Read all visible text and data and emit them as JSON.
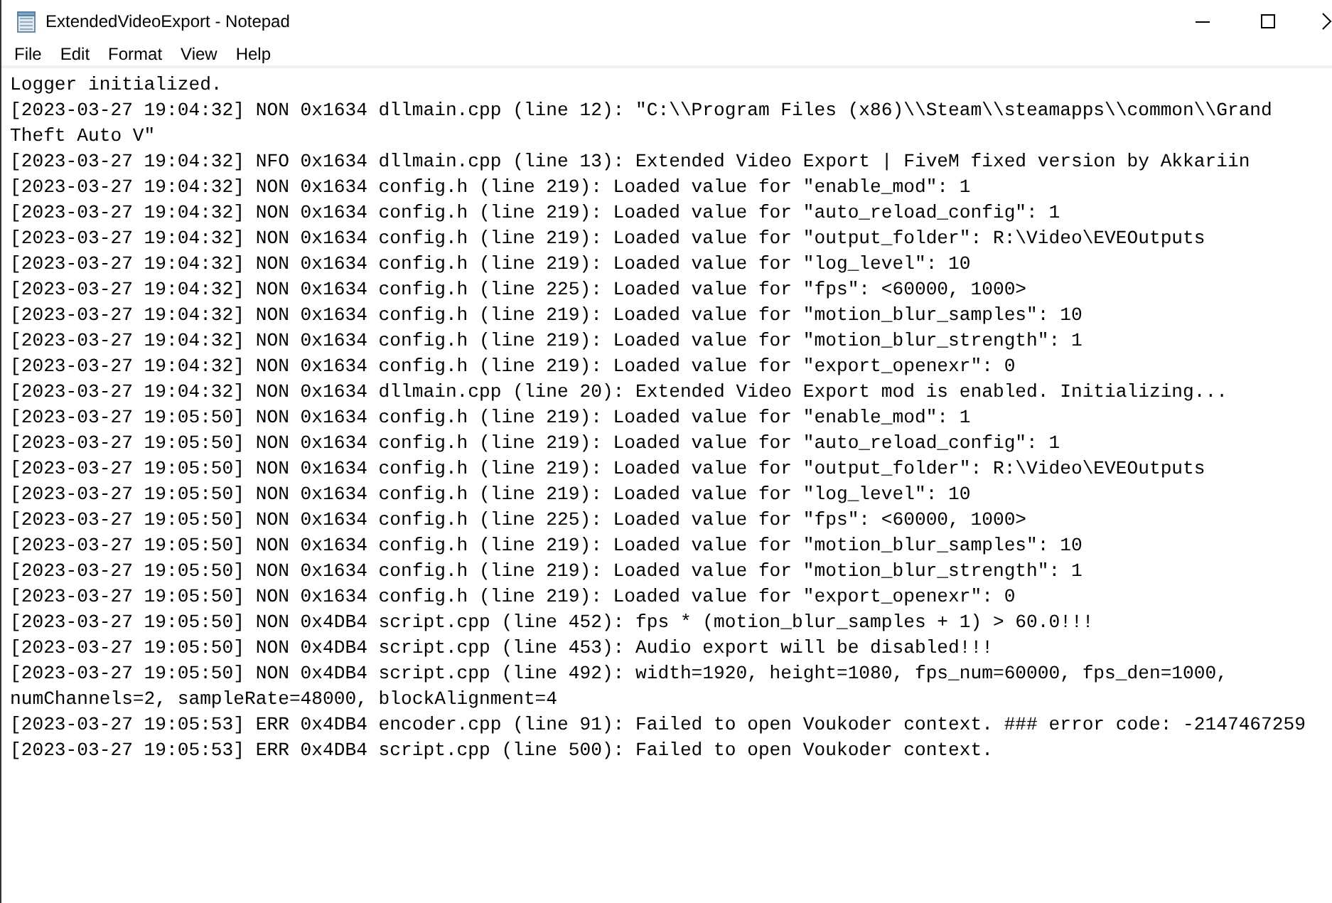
{
  "window": {
    "title": "ExtendedVideoExport - Notepad"
  },
  "menu": [
    "File",
    "Edit",
    "Format",
    "View",
    "Help"
  ],
  "lines": [
    "Logger initialized.",
    "[2023-03-27 19:04:32] NON 0x1634 dllmain.cpp (line 12): \"C:\\\\Program Files (x86)\\\\Steam\\\\steamapps\\\\common\\\\Grand",
    "Theft Auto V\"",
    "[2023-03-27 19:04:32] NFO 0x1634 dllmain.cpp (line 13): Extended Video Export | FiveM fixed version by Akkariin",
    "[2023-03-27 19:04:32] NON 0x1634 config.h (line 219): Loaded value for \"enable_mod\": 1",
    "[2023-03-27 19:04:32] NON 0x1634 config.h (line 219): Loaded value for \"auto_reload_config\": 1",
    "[2023-03-27 19:04:32] NON 0x1634 config.h (line 219): Loaded value for \"output_folder\": R:\\Video\\EVEOutputs",
    "[2023-03-27 19:04:32] NON 0x1634 config.h (line 219): Loaded value for \"log_level\": 10",
    "[2023-03-27 19:04:32] NON 0x1634 config.h (line 225): Loaded value for \"fps\": <60000, 1000>",
    "[2023-03-27 19:04:32] NON 0x1634 config.h (line 219): Loaded value for \"motion_blur_samples\": 10",
    "[2023-03-27 19:04:32] NON 0x1634 config.h (line 219): Loaded value for \"motion_blur_strength\": 1",
    "[2023-03-27 19:04:32] NON 0x1634 config.h (line 219): Loaded value for \"export_openexr\": 0",
    "[2023-03-27 19:04:32] NON 0x1634 dllmain.cpp (line 20): Extended Video Export mod is enabled. Initializing...",
    "[2023-03-27 19:05:50] NON 0x1634 config.h (line 219): Loaded value for \"enable_mod\": 1",
    "[2023-03-27 19:05:50] NON 0x1634 config.h (line 219): Loaded value for \"auto_reload_config\": 1",
    "[2023-03-27 19:05:50] NON 0x1634 config.h (line 219): Loaded value for \"output_folder\": R:\\Video\\EVEOutputs",
    "[2023-03-27 19:05:50] NON 0x1634 config.h (line 219): Loaded value for \"log_level\": 10",
    "[2023-03-27 19:05:50] NON 0x1634 config.h (line 225): Loaded value for \"fps\": <60000, 1000>",
    "[2023-03-27 19:05:50] NON 0x1634 config.h (line 219): Loaded value for \"motion_blur_samples\": 10",
    "[2023-03-27 19:05:50] NON 0x1634 config.h (line 219): Loaded value for \"motion_blur_strength\": 1",
    "[2023-03-27 19:05:50] NON 0x1634 config.h (line 219): Loaded value for \"export_openexr\": 0",
    "[2023-03-27 19:05:50] NON 0x4DB4 script.cpp (line 452): fps * (motion_blur_samples + 1) > 60.0!!!",
    "[2023-03-27 19:05:50] NON 0x4DB4 script.cpp (line 453): Audio export will be disabled!!!",
    "[2023-03-27 19:05:50] NON 0x4DB4 script.cpp (line 492): width=1920, height=1080, fps_num=60000, fps_den=1000,",
    "numChannels=2, sampleRate=48000, blockAlignment=4",
    "[2023-03-27 19:05:53] ERR 0x4DB4 encoder.cpp (line 91): Failed to open Voukoder context. ### error code: -2147467259",
    "[2023-03-27 19:05:53] ERR 0x4DB4 script.cpp (line 500): Failed to open Voukoder context."
  ]
}
